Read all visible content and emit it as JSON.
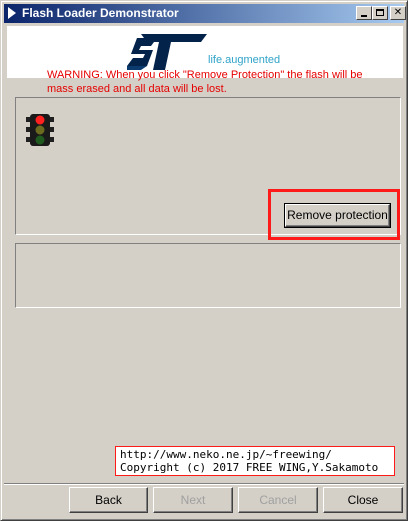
{
  "window": {
    "title": "Flash Loader Demonstrator",
    "caption_buttons": {
      "minimize": "_",
      "maximize": "□",
      "close": "✕"
    }
  },
  "header": {
    "brand_icon": "st-logo-icon",
    "tagline": "life.augmented"
  },
  "warning_panel": {
    "icon": "traffic-light-icon",
    "message": "WARNING: When you click \"Remove Protection\" the flash will be mass erased and all data will be lost.",
    "action_button_label": "Remove protection"
  },
  "credit": {
    "line1": "http://www.neko.ne.jp/~freewing/",
    "line2": "Copyright (c) 2017 FREE WING,Y.Sakamoto"
  },
  "footer": {
    "back_label": "Back",
    "next_label": "Next",
    "cancel_label": "Cancel",
    "close_label": "Close"
  },
  "colors": {
    "title_bar_start": "#0a246a",
    "title_bar_end": "#a6caf0",
    "warning_text": "#e60000",
    "highlight": "#ff1a1a",
    "brand_blue": "#03234b",
    "tagline_blue": "#2fa3c9"
  }
}
